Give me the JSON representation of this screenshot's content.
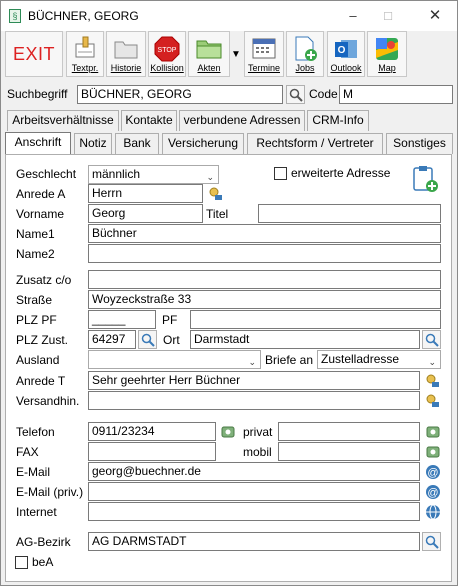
{
  "window": {
    "title": "BÜCHNER, GEORG"
  },
  "toolbar": {
    "exit": "EXIT",
    "textpr": "Textpr.",
    "historie": "Historie",
    "kollision": "Kollision",
    "kollision_stop": "STOP",
    "akten": "Akten",
    "termine": "Termine",
    "jobs": "Jobs",
    "outlook": "Outlook",
    "map": "Map"
  },
  "search": {
    "label": "Suchbegriff",
    "value": "BÜCHNER, GEORG",
    "code_label": "Code",
    "code_value": "M"
  },
  "tabs_row1": [
    "Arbeitsverhältnisse",
    "Kontakte",
    "verbundene Adressen",
    "CRM-Info"
  ],
  "tabs_row2": [
    "Anschrift",
    "Notiz",
    "Bank",
    "Versicherung",
    "Rechtsform / Vertreter",
    "Sonstiges"
  ],
  "form": {
    "geschlecht_label": "Geschlecht",
    "geschlecht_value": "männlich",
    "erweiterte_label": "erweiterte Adresse",
    "anrede_a_label": "Anrede A",
    "anrede_a_value": "Herrn",
    "vorname_label": "Vorname",
    "vorname_value": "Georg",
    "titel_label": "Titel",
    "titel_value": "",
    "name1_label": "Name1",
    "name1_value": "Büchner",
    "name2_label": "Name2",
    "name2_value": "",
    "zusatz_label": "Zusatz  c/o",
    "zusatz_value": "",
    "strasse_label": "Straße",
    "strasse_value": "Woyzeckstraße 33",
    "plz_pf_label": "PLZ PF",
    "plz_pf_value": "_____",
    "pf_label": "PF",
    "pf_value": "",
    "plz_zust_label": "PLZ Zust.",
    "plz_zust_value": "64297",
    "ort_label": "Ort",
    "ort_value": "Darmstadt",
    "ausland_label": "Ausland",
    "ausland_value": "",
    "briefe_an_label": "Briefe an",
    "briefe_an_value": "Zustelladresse",
    "anrede_t_label": "Anrede T",
    "anrede_t_value": "Sehr geehrter Herr Büchner",
    "versandhin_label": "Versandhin.",
    "versandhin_value": "",
    "telefon_label": "Telefon",
    "telefon_value": "0911/23234",
    "privat_label": "privat",
    "privat_value": "",
    "fax_label": "FAX",
    "fax_value": "",
    "mobil_label": "mobil",
    "mobil_value": "",
    "email_label": "E-Mail",
    "email_value": "georg@buechner.de",
    "email_priv_label": "E-Mail (priv.)",
    "email_priv_value": "",
    "internet_label": "Internet",
    "internet_value": "",
    "ag_bezirk_label": "AG-Bezirk",
    "ag_bezirk_value": "AG DARMSTADT",
    "bea_label": "beA"
  }
}
